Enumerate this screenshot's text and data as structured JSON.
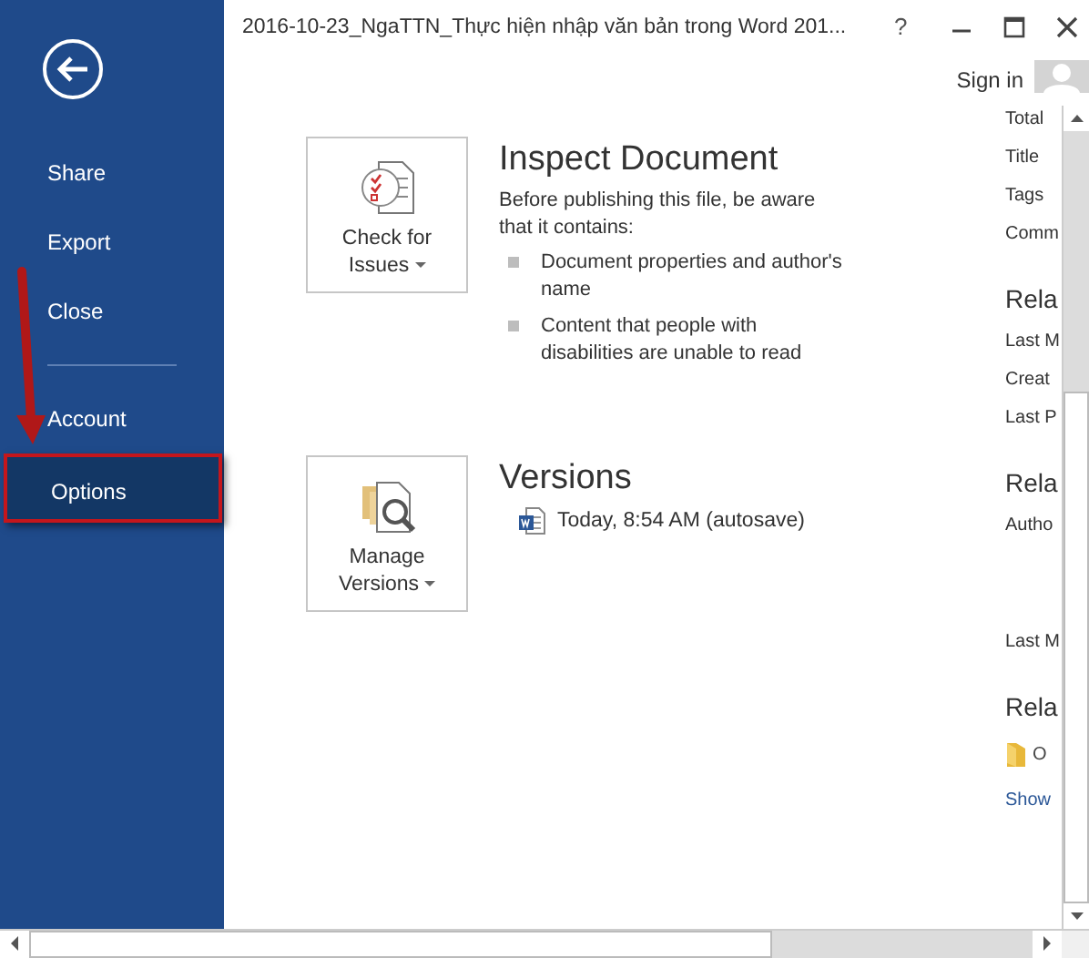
{
  "window": {
    "title": "2016-10-23_NgaTTN_Thực hiện nhập văn bản trong Word 201...",
    "help": "?"
  },
  "account": {
    "label": "Sign in"
  },
  "sidebar": {
    "items": [
      {
        "label": "Share",
        "selected": false,
        "highlighted": false,
        "separator_before": false
      },
      {
        "label": "Export",
        "selected": false,
        "highlighted": false,
        "separator_before": false
      },
      {
        "label": "Close",
        "selected": false,
        "highlighted": false,
        "separator_before": false
      },
      {
        "label": "Account",
        "selected": false,
        "highlighted": false,
        "separator_before": true
      },
      {
        "label": "Options",
        "selected": true,
        "highlighted": true,
        "separator_before": false
      }
    ]
  },
  "sections": [
    {
      "kind": "inspect",
      "button": "Check for Issues",
      "heading": "Inspect Document",
      "description": "Before publishing this file, be aware that it contains:",
      "bullets": [
        "Document properties and author's name",
        "Content that people with disabilities are unable to read"
      ]
    },
    {
      "kind": "versions",
      "button": "Manage Versions",
      "heading": "Versions",
      "versions": [
        "Today, 8:54 AM (autosave)"
      ]
    }
  ],
  "properties_panel": {
    "items": [
      {
        "kind": "field",
        "text": "Total"
      },
      {
        "kind": "field",
        "text": "Title"
      },
      {
        "kind": "field",
        "text": "Tags"
      },
      {
        "kind": "field",
        "text": "Comm"
      },
      {
        "kind": "heading",
        "text": "Rela"
      },
      {
        "kind": "field",
        "text": "Last M"
      },
      {
        "kind": "field",
        "text": "Creat"
      },
      {
        "kind": "field",
        "text": "Last P"
      },
      {
        "kind": "heading",
        "text": "Rela"
      },
      {
        "kind": "person",
        "text": "Autho"
      },
      {
        "kind": "field",
        "text": "Last M"
      },
      {
        "kind": "heading",
        "text": "Rela"
      },
      {
        "kind": "folder",
        "text": "O"
      },
      {
        "kind": "link",
        "text": "Show"
      }
    ]
  }
}
